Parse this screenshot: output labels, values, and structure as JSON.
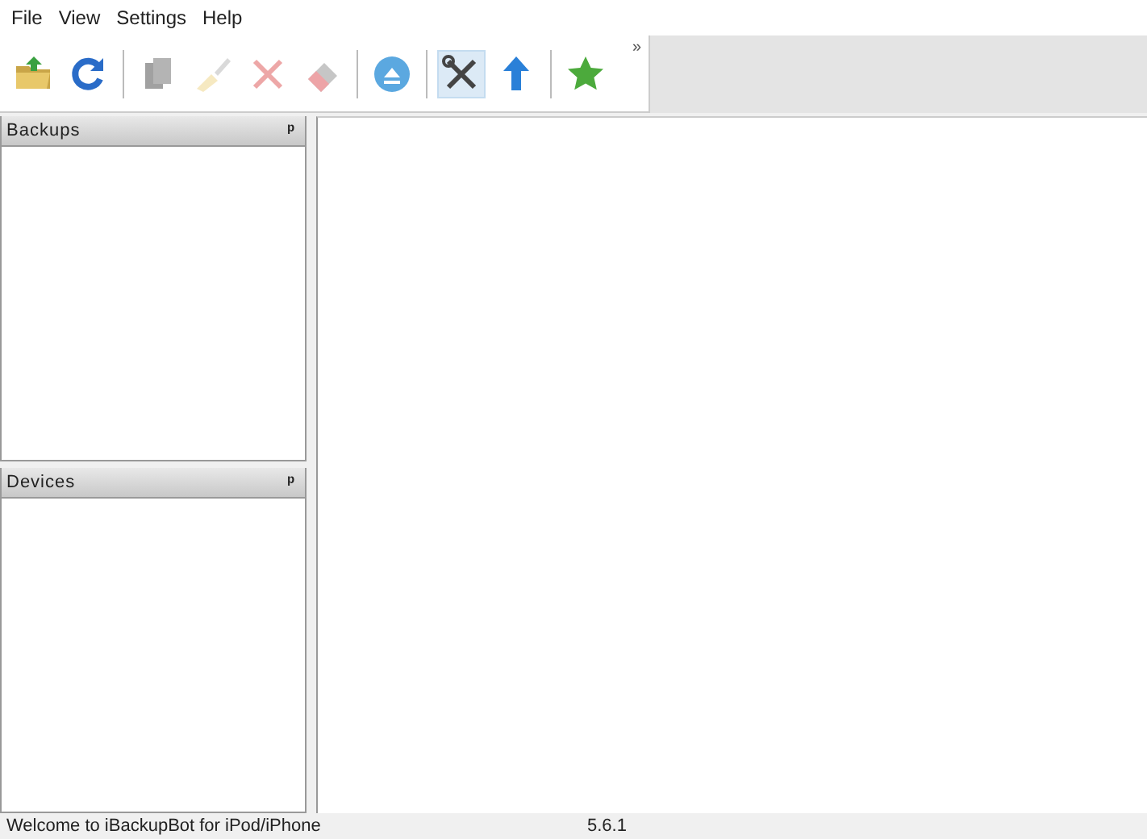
{
  "menu": [
    "File",
    "View",
    "Settings",
    "Help"
  ],
  "toolbar": [
    {
      "kind": "button",
      "disabled": false,
      "selected": false
    },
    {
      "kind": "button",
      "disabled": false,
      "selected": false
    },
    {
      "kind": "separator"
    },
    {
      "kind": "button",
      "disabled": true,
      "selected": false
    },
    {
      "kind": "button",
      "disabled": true,
      "selected": false
    },
    {
      "kind": "button",
      "disabled": true,
      "selected": false
    },
    {
      "kind": "button",
      "disabled": true,
      "selected": false
    },
    {
      "kind": "separator"
    },
    {
      "kind": "button",
      "disabled": false,
      "selected": false
    },
    {
      "kind": "separator"
    },
    {
      "kind": "button",
      "disabled": false,
      "selected": true
    },
    {
      "kind": "button",
      "disabled": false,
      "selected": false
    },
    {
      "kind": "separator"
    },
    {
      "kind": "button",
      "disabled": false,
      "selected": false
    }
  ],
  "toolbar_overflow": "»",
  "panels": [
    {
      "title": "Backups",
      "pin": "ᵖ"
    },
    {
      "title": "Devices",
      "pin": "ᵖ"
    }
  ],
  "status_bar": {
    "message": "Welcome to iBackupBot for iPod/iPhone",
    "version": "5.6.1"
  }
}
